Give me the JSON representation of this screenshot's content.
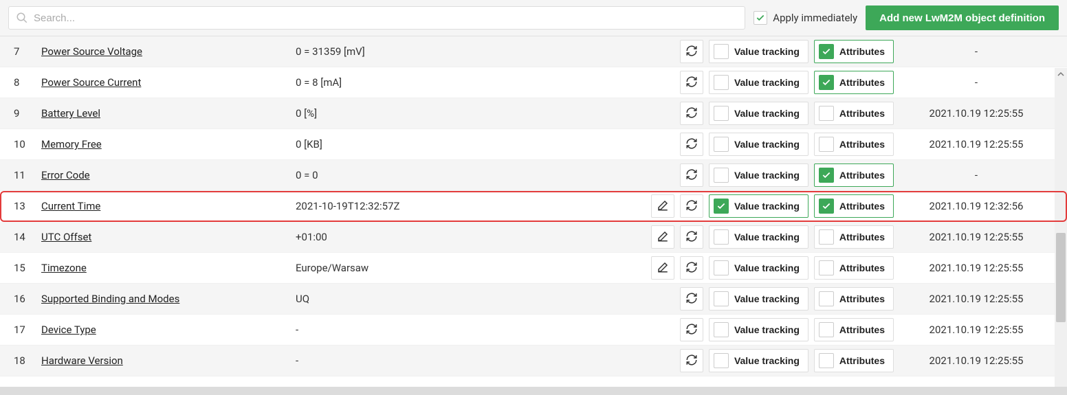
{
  "toolbar": {
    "search_placeholder": "Search...",
    "apply_label": "Apply immediately",
    "apply_checked": true,
    "add_button": "Add new LwM2M object definition"
  },
  "rows": [
    {
      "id": "7",
      "name": "Power Source Voltage",
      "value": "0 = 31359 [mV]",
      "edit": false,
      "vt_on": false,
      "attr_on": true,
      "ts": "-"
    },
    {
      "id": "8",
      "name": "Power Source Current",
      "value": "0 = 8 [mA]",
      "edit": false,
      "vt_on": false,
      "attr_on": true,
      "ts": "-"
    },
    {
      "id": "9",
      "name": "Battery Level",
      "value": "0 [%]",
      "edit": false,
      "vt_on": false,
      "attr_on": false,
      "ts": "2021.10.19 12:25:55"
    },
    {
      "id": "10",
      "name": "Memory Free",
      "value": "0 [KB]",
      "edit": false,
      "vt_on": false,
      "attr_on": false,
      "ts": "2021.10.19 12:25:55"
    },
    {
      "id": "11",
      "name": "Error Code",
      "value": "0 = 0",
      "edit": false,
      "vt_on": false,
      "attr_on": true,
      "ts": "-"
    },
    {
      "id": "13",
      "name": "Current Time",
      "value": "2021-10-19T12:32:57Z",
      "edit": true,
      "vt_on": true,
      "attr_on": true,
      "ts": "2021.10.19 12:32:56",
      "highlight": true
    },
    {
      "id": "14",
      "name": "UTC Offset",
      "value": "+01:00",
      "edit": true,
      "vt_on": false,
      "attr_on": false,
      "ts": "2021.10.19 12:25:55"
    },
    {
      "id": "15",
      "name": "Timezone",
      "value": "Europe/Warsaw",
      "edit": true,
      "vt_on": false,
      "attr_on": false,
      "ts": "2021.10.19 12:25:55"
    },
    {
      "id": "16",
      "name": "Supported Binding and Modes",
      "value": "UQ",
      "edit": false,
      "vt_on": false,
      "attr_on": false,
      "ts": "2021.10.19 12:25:55"
    },
    {
      "id": "17",
      "name": "Device Type",
      "value": "-",
      "edit": false,
      "vt_on": false,
      "attr_on": false,
      "ts": "2021.10.19 12:25:55"
    },
    {
      "id": "18",
      "name": "Hardware Version",
      "value": "-",
      "edit": false,
      "vt_on": false,
      "attr_on": false,
      "ts": "2021.10.19 12:25:55"
    }
  ],
  "labels": {
    "value_tracking": "Value tracking",
    "attributes": "Attributes"
  }
}
